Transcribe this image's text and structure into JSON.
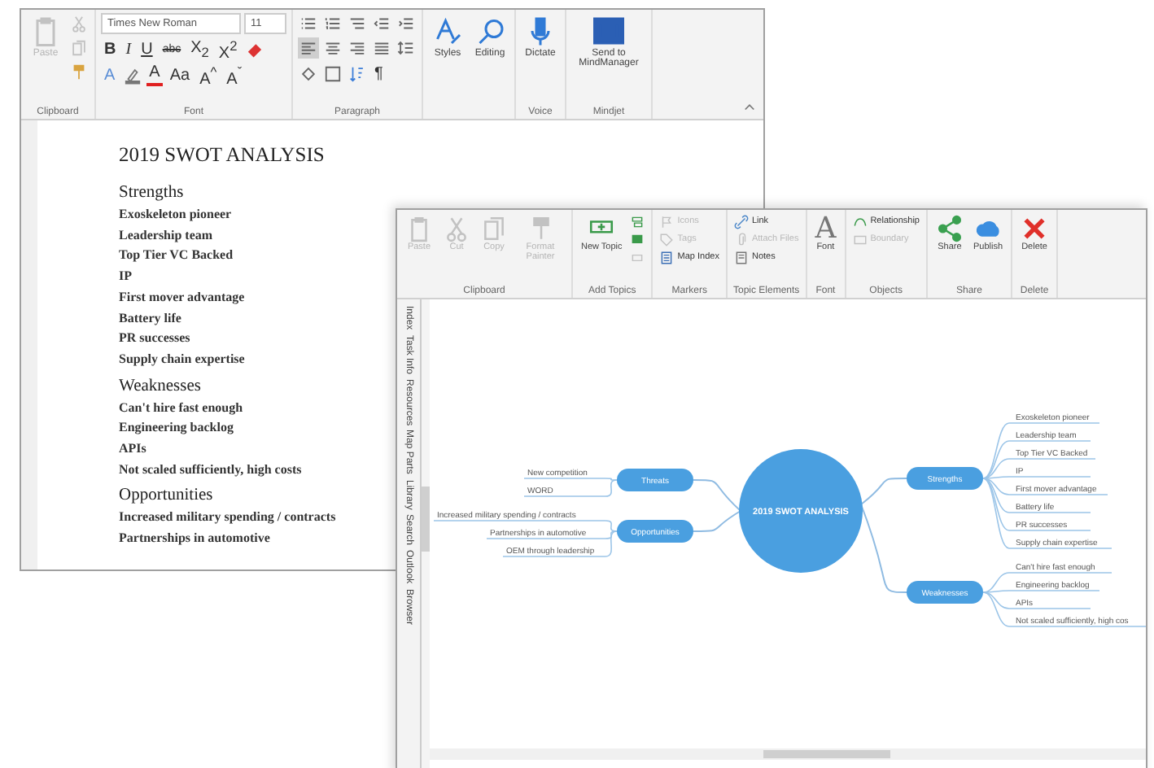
{
  "word_window": {
    "ribbon": {
      "groups": [
        {
          "label": "Clipboard",
          "large": [
            {
              "kind": "paste",
              "label": "Paste",
              "disabled": true
            }
          ],
          "rows": [
            [
              {
                "kind": "cut",
                "disabled": true
              }
            ],
            [
              {
                "kind": "copy",
                "disabled": true
              }
            ],
            [
              {
                "kind": "format-painter",
                "disabled": false
              }
            ]
          ]
        },
        {
          "label": "Font",
          "rows": [
            [
              {
                "kind": "font-name",
                "value": "Times New Roman"
              },
              {
                "kind": "font-size",
                "value": "11"
              }
            ],
            [
              {
                "kind": "bold",
                "text": "B"
              },
              {
                "kind": "italic",
                "text": "I"
              },
              {
                "kind": "underline",
                "text": "U"
              },
              {
                "kind": "strike",
                "text": "abc"
              },
              {
                "kind": "script",
                "text": "X$_{2}$"
              },
              {
                "kind": "script",
                "text": "X$^{2}$"
              },
              {
                "kind": "clear"
              }
            ],
            [
              {
                "kind": "effects",
                "text": "A"
              },
              {
                "kind": "highlight"
              },
              {
                "kind": "font-color",
                "text": "A"
              },
              {
                "kind": "case",
                "text": "Aa"
              },
              {
                "kind": "grow",
                "text": "A$^{^}$"
              },
              {
                "kind": "grow",
                "text": "A$^{ˇ}$"
              }
            ]
          ]
        },
        {
          "label": "Paragraph",
          "rows": [
            [
              {
                "kind": "bullets"
              },
              {
                "kind": "numbering"
              },
              {
                "kind": "multilevel"
              },
              {
                "kind": "outdent"
              },
              {
                "kind": "indent"
              }
            ],
            [
              {
                "kind": "align-left",
                "selected": true
              },
              {
                "kind": "align-center",
                "selected": false
              },
              {
                "kind": "align-right",
                "selected": false
              },
              {
                "kind": "justify",
                "selected": false
              },
              {
                "kind": "spacing"
              }
            ],
            [
              {
                "kind": "shading"
              },
              {
                "kind": "borders"
              },
              {
                "kind": "sort"
              },
              {
                "kind": "mark",
                "text": "¶"
              }
            ]
          ]
        },
        {
          "large": [
            {
              "kind": "styles",
              "label": "Styles"
            },
            {
              "kind": "editing",
              "label": "Editing"
            }
          ]
        },
        {
          "label": "Voice",
          "large": [
            {
              "kind": "dictate",
              "label": "Dictate"
            }
          ]
        },
        {
          "label": "Mindjet",
          "large": [
            {
              "kind": "mindmanager",
              "label": "Send to MindManager"
            }
          ]
        }
      ]
    },
    "document": {
      "title": "2019 SWOT ANALYSIS",
      "sections": [
        {
          "heading": "Strengths",
          "items": [
            "Exoskeleton pioneer",
            "Leadership team",
            "Top Tier VC Backed",
            "IP",
            "First mover advantage",
            "Battery life",
            "PR successes",
            "Supply chain expertise"
          ]
        },
        {
          "heading": "Weaknesses",
          "items": [
            "Can't hire fast enough",
            "Engineering backlog",
            "APIs",
            "Not scaled sufficiently, high costs"
          ]
        },
        {
          "heading": "Opportunities",
          "items": [
            "Increased military spending / contracts",
            "Partnerships in automotive"
          ]
        }
      ]
    }
  },
  "mindmanager_window": {
    "ribbon": {
      "groups": [
        {
          "label": "Clipboard",
          "large": [
            {
              "kind": "paste",
              "label": "Paste",
              "disabled": true
            },
            {
              "kind": "cut",
              "label": "Cut",
              "disabled": true
            },
            {
              "kind": "copy",
              "label": "Copy",
              "disabled": true
            },
            {
              "kind": "format-painter",
              "label": "Format Painter",
              "disabled": true
            }
          ]
        },
        {
          "label": "Add Topics",
          "large": [
            {
              "kind": "new-topic",
              "label": "New Topic"
            }
          ],
          "rows": [
            [
              {
                "kind": "subtopic"
              }
            ],
            [
              {
                "kind": "callout"
              }
            ],
            [
              {
                "kind": "floating",
                "disabled": true
              }
            ]
          ]
        },
        {
          "label": "Markers",
          "rows": [
            [
              {
                "kind": "icons",
                "label": "Icons",
                "disabled": true
              }
            ],
            [
              {
                "kind": "tags",
                "label": "Tags",
                "disabled": true
              }
            ],
            [
              {
                "kind": "map-index",
                "label": "Map Index",
                "disabled": false
              }
            ]
          ]
        },
        {
          "label": "Topic Elements",
          "rows": [
            [
              {
                "kind": "link",
                "label": "Link",
                "disabled": false
              }
            ],
            [
              {
                "kind": "attach",
                "label": "Attach Files",
                "disabled": true
              }
            ],
            [
              {
                "kind": "notes",
                "label": "Notes",
                "disabled": false
              }
            ]
          ]
        },
        {
          "label": "Font",
          "large": [
            {
              "kind": "font-glyph",
              "text": "A",
              "label": "Font"
            }
          ]
        },
        {
          "label": "Objects",
          "rows": [
            [
              {
                "kind": "relationship",
                "label": "Relationship",
                "disabled": false
              }
            ],
            [
              {
                "kind": "boundary",
                "label": "Boundary",
                "disabled": true
              }
            ]
          ]
        },
        {
          "label": "Share",
          "large": [
            {
              "kind": "share",
              "label": "Share"
            },
            {
              "kind": "publish",
              "label": "Publish"
            }
          ]
        },
        {
          "label": "Delete",
          "large": [
            {
              "kind": "delete",
              "label": "Delete"
            }
          ]
        }
      ]
    },
    "side_tabs": [
      "Index",
      "Task Info",
      "Resources",
      "Map Parts",
      "Library",
      "Search",
      "Outlook",
      "Browser"
    ],
    "map": {
      "central": "2019 SWOT ANALYSIS",
      "left_branches": [
        {
          "label": "Threats",
          "children": [
            "New competition",
            "WORD"
          ]
        },
        {
          "label": "Opportunities",
          "children": [
            "Increased military spending / contracts",
            "Partnerships in automotive",
            "OEM through leadership"
          ]
        }
      ],
      "right_branches": [
        {
          "label": "Strengths",
          "children": [
            "Exoskeleton pioneer",
            "Leadership team",
            "Top Tier VC Backed",
            "IP",
            "First mover advantage",
            "Battery life",
            "PR successes",
            "Supply chain expertise"
          ]
        },
        {
          "label": "Weaknesses",
          "children": [
            "Can't hire fast enough",
            "Engineering backlog",
            "APIs",
            "Not scaled sufficiently, high cos"
          ]
        }
      ]
    }
  }
}
